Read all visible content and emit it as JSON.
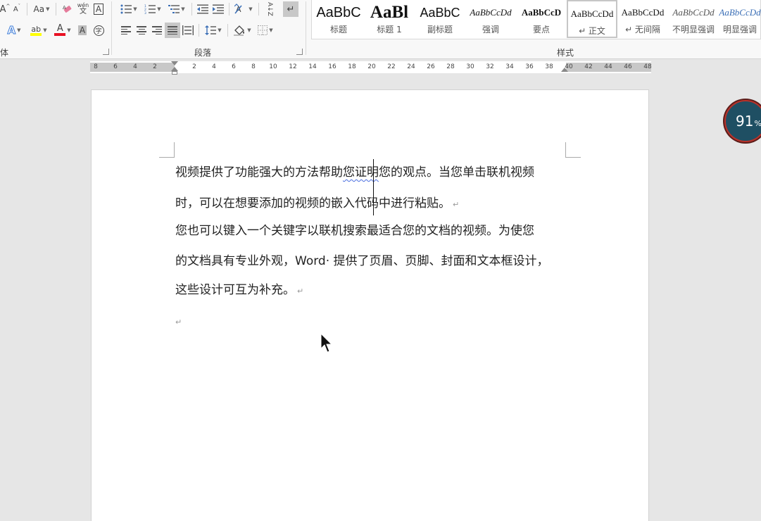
{
  "ribbon": {
    "font_group": {
      "label": "体",
      "grow_font": "A",
      "shrink_font": "A",
      "change_case": "Aa",
      "phonetic_top": "wén",
      "phonetic_bottom": "文",
      "char_border": "A",
      "font_color": "A",
      "char_shading": "A",
      "enclose": "字",
      "highlight": "ab",
      "text_effects": "A"
    },
    "paragraph_group": {
      "label": "段落",
      "sort": "A↓Z"
    },
    "styles_group": {
      "label": "样式",
      "items": [
        {
          "sample": "AaBbC",
          "name": "标题"
        },
        {
          "sample": "AaBl",
          "name": "标题 1"
        },
        {
          "sample": "AaBbC",
          "name": "副标题"
        },
        {
          "sample": "AaBbCcDd",
          "name": "强调"
        },
        {
          "sample": "AaBbCcD",
          "name": "要点"
        },
        {
          "sample": "AaBbCcDd",
          "name": "↵ 正文"
        },
        {
          "sample": "AaBbCcDd",
          "name": "↵ 无间隔"
        },
        {
          "sample": "AaBbCcDd",
          "name": "不明显强调"
        },
        {
          "sample": "AaBbCcDd",
          "name": "明显强调"
        }
      ]
    }
  },
  "ruler": {
    "left_ticks": [
      "8",
      "6",
      "4",
      "2"
    ],
    "right_ticks": [
      "2",
      "4",
      "6",
      "8",
      "10",
      "12",
      "14",
      "16",
      "18",
      "20",
      "22",
      "24",
      "26",
      "28",
      "30",
      "32",
      "34",
      "36",
      "38",
      "40",
      "42",
      "44",
      "46",
      "48"
    ]
  },
  "document": {
    "p1_line1_a": "视频提供了功能强大的方法帮助",
    "p1_line1_b": "您证明",
    "p1_line1_c": "您的观点。当您单击联机视频",
    "p1_line2": "时，可以在想要添加的视频的嵌入代码中进行粘贴。",
    "p2_line1": "您也可以键入一个关键字以联机搜索最适合您的文档的视频。为使您",
    "p2_line2": "的文档具有专业外观，Word· 提供了页眉、页脚、封面和文本框设计，",
    "p2_line3": "这些设计可互为补充。",
    "paragraph_mark": "↵"
  },
  "badge": {
    "value": "91",
    "unit": "%"
  },
  "colors": {
    "highlight_yellow": "#ffff00",
    "font_red": "#e81123",
    "badge_bg": "#1f4f63",
    "badge_ring": "#b8322a",
    "squiggle_blue": "#4a6ee0"
  }
}
